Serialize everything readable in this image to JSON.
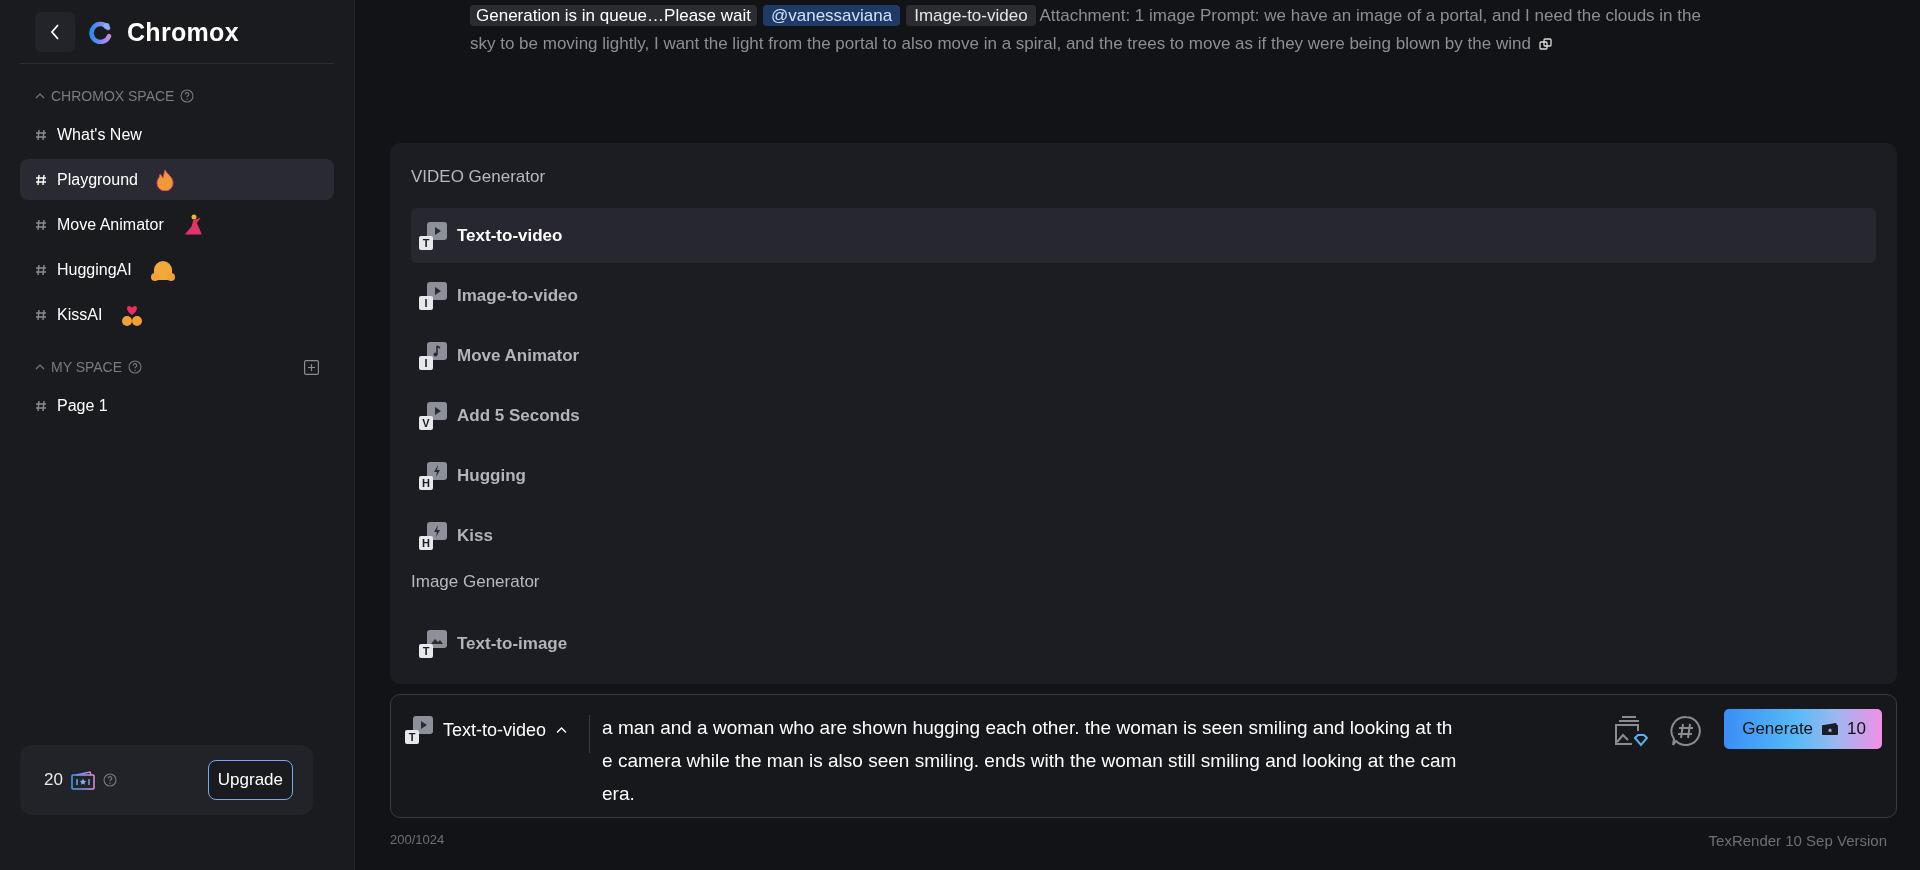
{
  "sidebar": {
    "logo": "Chromox",
    "sections": [
      {
        "title": "CHROMOX SPACE",
        "expanded": true,
        "add": false,
        "items": [
          {
            "kind": "plain",
            "label": "What's New",
            "selected": false
          },
          {
            "kind": "fire",
            "label": "Playground",
            "selected": true
          },
          {
            "kind": "dancer",
            "label": "Move Animator",
            "selected": false
          },
          {
            "kind": "hug",
            "label": "HuggingAI",
            "selected": false
          },
          {
            "kind": "heart",
            "label": "KissAI",
            "selected": false
          }
        ]
      },
      {
        "title": "MY SPACE",
        "expanded": true,
        "add": true,
        "items": [
          {
            "kind": "plain",
            "label": "Page 1",
            "selected": false
          }
        ]
      }
    ],
    "credits": "20",
    "upgrade": "Upgrade"
  },
  "message": {
    "status": "Generation is in queue…Please wait",
    "tags": [
      {
        "kind": "mention",
        "text": "@vanessaviana"
      },
      {
        "kind": "tag",
        "text": "Image-to-video"
      }
    ],
    "text": "Attachment: 1 image  Prompt: we have an image of a portal, and I need the clouds in the sky to be moving lightly, I want the light from the portal to also move in a spiral, and the trees to move as if they were being blown by the wind"
  },
  "menu": {
    "groups": [
      {
        "title": "VIDEO Generator",
        "items": [
          {
            "kind": "play",
            "label": "Text-to-video",
            "badge": "T",
            "selected": true
          },
          {
            "kind": "play",
            "label": "Image-to-video",
            "badge": "I",
            "selected": false
          },
          {
            "kind": "note",
            "label": "Move Animator",
            "badge": "I",
            "selected": false
          },
          {
            "kind": "play",
            "label": "Add 5 Seconds",
            "badge": "V",
            "selected": false
          },
          {
            "kind": "bolt",
            "label": "Hugging",
            "badge": "H",
            "selected": false
          },
          {
            "kind": "bolt",
            "label": "Kiss",
            "badge": "H",
            "selected": false
          }
        ]
      },
      {
        "title": "Image Generator",
        "items": [
          {
            "kind": "image",
            "label": "Text-to-image",
            "badge": "T",
            "selected": false
          }
        ]
      }
    ]
  },
  "composer": {
    "mode": {
      "kind": "play",
      "label": "Text-to-video",
      "badge": "T",
      "expanded": true
    },
    "value": "a man and a woman who are shown hugging each other. the woman is seen smiling and looking at the camera while the man is also seen smiling. ends with the woman still smiling and looking at the camera.",
    "generate": {
      "label": "Generate",
      "cost": "10"
    },
    "counter": "200/1024",
    "version": "TexRender 10 Sep Version"
  }
}
